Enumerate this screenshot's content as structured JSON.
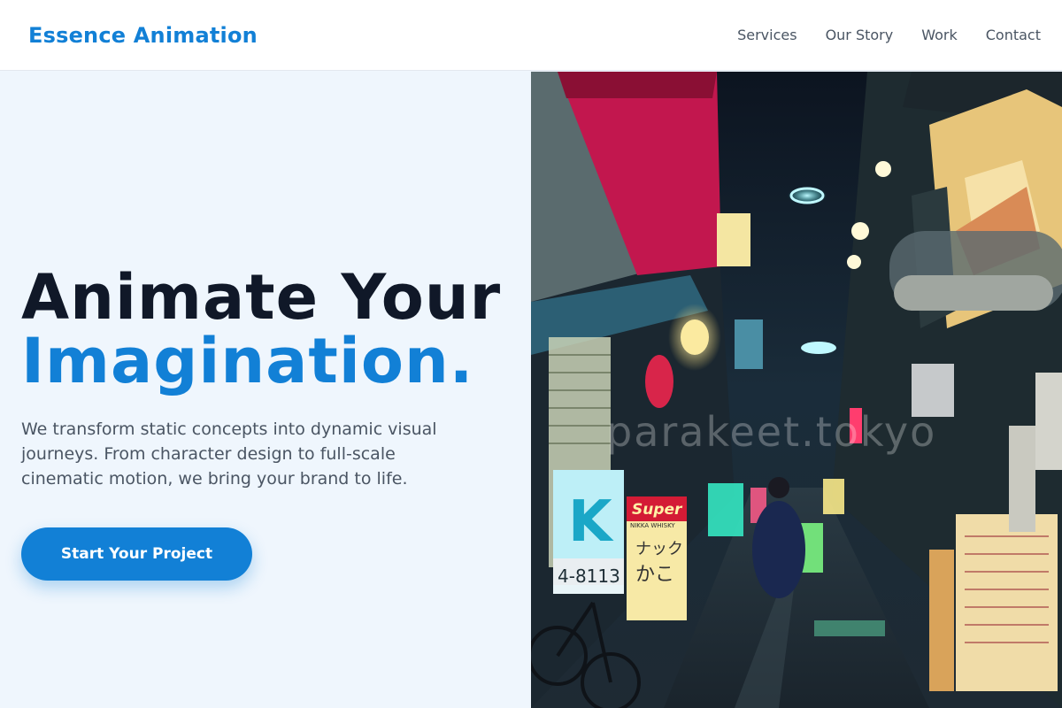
{
  "header": {
    "brand": "Essence Animation",
    "nav": [
      {
        "label": "Services"
      },
      {
        "label": "Our Story"
      },
      {
        "label": "Work"
      },
      {
        "label": "Contact"
      }
    ]
  },
  "hero": {
    "headline_line1": "Animate Your",
    "headline_line2": "Imagination.",
    "description": "We transform static concepts into dynamic visual journeys. From character design to full-scale cinematic motion, we bring your brand to life.",
    "cta_label": "Start Your Project"
  },
  "image": {
    "subject": "neon-lit Tokyo alley at night",
    "watermark": "parakeet.tokyo",
    "sign_super": "Super",
    "sign_super_sub": "NIKKA WHISKY",
    "sign_phone": "4-8113",
    "sign_snack_1": "ナック",
    "sign_snack_2": "かこ",
    "sign_k": "K"
  },
  "colors": {
    "accent": "#1280d6",
    "heading": "#101828",
    "body_text": "#4a5563",
    "hero_bg": "#eff6fd"
  }
}
